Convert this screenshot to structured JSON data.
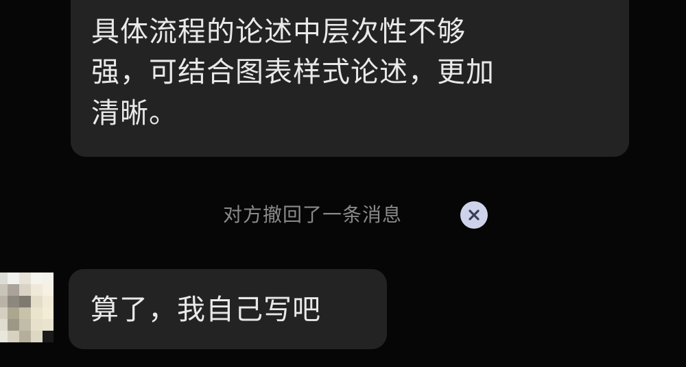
{
  "messages": {
    "received_top": {
      "lines": [
        "具体流程的论述中层次性不够",
        "强，可结合图表样式论述，更加",
        "清晰。"
      ]
    },
    "system_notice": {
      "text": "对方撤回了一条消息",
      "dismiss_icon": "close-circle-icon"
    },
    "received_bottom": {
      "text": "算了，我自己写吧"
    }
  },
  "colors": {
    "background": "#060606",
    "bubble": "#232323",
    "message_text": "#e9e9e9",
    "notice_text": "#8a8a8a",
    "dismiss_bg": "#cfd3ea",
    "dismiss_cross": "#3a3d55"
  }
}
